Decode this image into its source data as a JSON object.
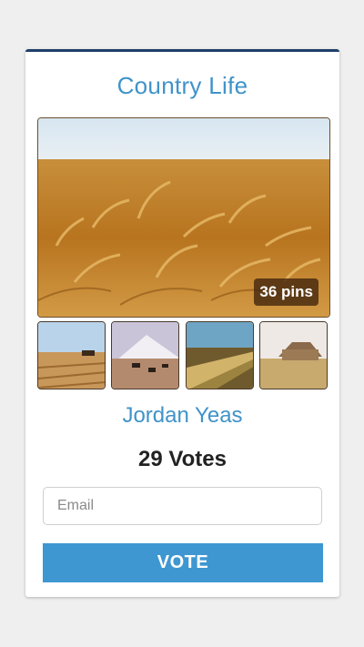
{
  "card": {
    "title": "Country Life",
    "pins_badge": "36 pins",
    "author": "Jordan Yeas",
    "votes": "29 Votes",
    "email_placeholder": "Email",
    "vote_label": "VOTE"
  },
  "colors": {
    "accent": "#3f93c9",
    "button": "#3e97d1",
    "card_top_border": "#1f3f6b"
  }
}
